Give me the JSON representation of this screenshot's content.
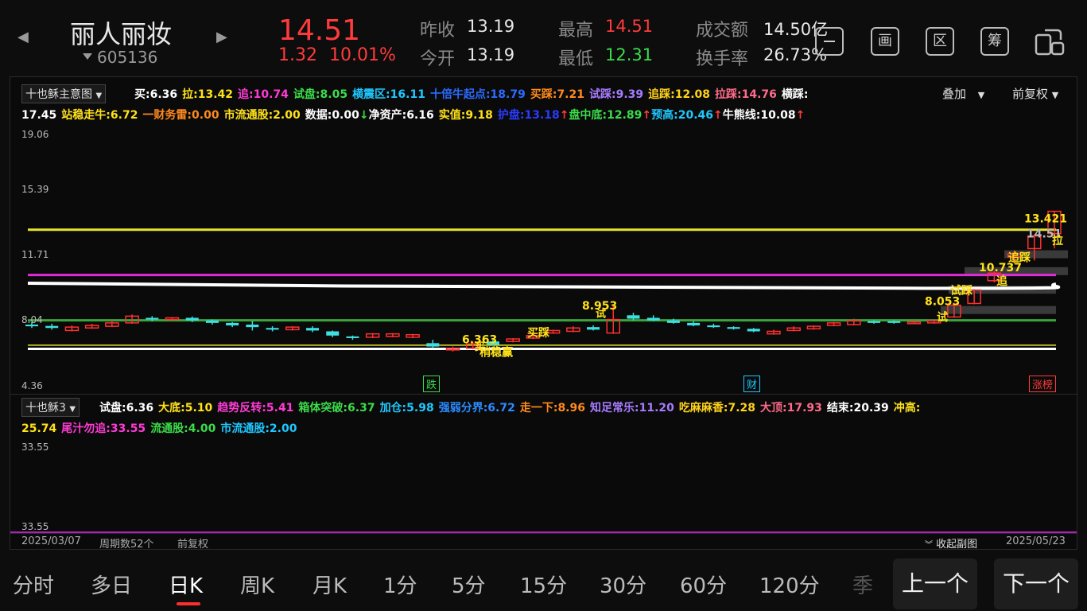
{
  "header": {
    "stock_name": "丽人丽妆",
    "stock_code": "605136",
    "price": "14.51",
    "change_abs": "1.32",
    "change_pct": "10.01%",
    "quotes": [
      {
        "label": "昨收",
        "value": "13.19",
        "color": "#e8e8e8"
      },
      {
        "label": "今开",
        "value": "13.19",
        "color": "#e8e8e8"
      },
      {
        "label": "最高",
        "value": "14.51",
        "color": "#ff3b3b"
      },
      {
        "label": "最低",
        "value": "12.31",
        "color": "#3bdc4a"
      },
      {
        "label": "成交额",
        "value": "14.50亿",
        "color": "#e8e8e8"
      },
      {
        "label": "换手率",
        "value": "26.73%",
        "color": "#e8e8e8"
      }
    ],
    "tool_icons": [
      "collapse-icon",
      "drawing-icon",
      "zone-icon",
      "chip-icon",
      "multi-window-icon"
    ],
    "tool_glyphs": [
      "",
      "画",
      "区",
      "筹",
      ""
    ]
  },
  "main_chart": {
    "indicator_name": "十也稣主意图",
    "overlay_label": "叠加",
    "adjust_label": "前复权",
    "line1": [
      {
        "text": "买:6.36",
        "color": "#ffffff"
      },
      {
        "text": "拉:13.42",
        "color": "#ffe21a"
      },
      {
        "text": "追:10.74",
        "color": "#ff3bd6"
      },
      {
        "text": "试盘:8.05",
        "color": "#3bdc4a"
      },
      {
        "text": "横震区:16.11",
        "color": "#1ec8ff"
      },
      {
        "text": "十倍牛起点:18.79",
        "color": "#2b6bff"
      },
      {
        "text": "买踩:7.21",
        "color": "#ff8a1e"
      },
      {
        "text": "试踩:9.39",
        "color": "#a77bff"
      },
      {
        "text": "追踩:12.08",
        "color": "#ffd21a"
      },
      {
        "text": "拉踩:14.76",
        "color": "#ff6b8a"
      },
      {
        "text": "横踩:",
        "color": "#ffffff"
      }
    ],
    "line2": [
      {
        "text": "17.45",
        "color": "#ffffff"
      },
      {
        "text": "站稳走牛:6.72",
        "color": "#ffe21a"
      },
      {
        "text": "一财务雷:0.00",
        "color": "#ff8a1e"
      },
      {
        "text": "市流通股:2.00",
        "color": "#ffe21a"
      },
      {
        "text": "数据:0.00",
        "color": "#ffffff"
      },
      {
        "text": "↓",
        "color": "#3bdc4a"
      },
      {
        "text": "净资产:6.16",
        "color": "#ffffff"
      },
      {
        "text": "实值:9.18",
        "color": "#ffe21a"
      },
      {
        "text": "护盘:13.18",
        "color": "#2b3bff"
      },
      {
        "text": "↑",
        "color": "#ff3b3b"
      },
      {
        "text": "盘中底:12.89",
        "color": "#3bdc4a"
      },
      {
        "text": "↑",
        "color": "#ff3b3b"
      },
      {
        "text": "预高:20.46",
        "color": "#1ec8ff"
      },
      {
        "text": "↑",
        "color": "#ff3b3b"
      },
      {
        "text": "牛熊线:10.08",
        "color": "#ffffff"
      },
      {
        "text": "↑",
        "color": "#ff3b3b"
      }
    ],
    "y_labels": [
      "19.06",
      "15.39",
      "11.71",
      "8.04",
      "4.36"
    ],
    "markers": [
      {
        "text": "跌",
        "color": "#3bdc4a"
      },
      {
        "text": "财",
        "color": "#1ec8ff"
      },
      {
        "text": "涨榜",
        "color": "#ff3b3b"
      }
    ],
    "annotations": [
      "13.421",
      "14.51",
      "拉",
      "追踩",
      "10.737",
      "追",
      "试踩",
      "8.053",
      "试",
      "8.953",
      "试",
      "买踩",
      "6.363",
      "买",
      "稍稳赢"
    ]
  },
  "sub_chart": {
    "indicator_name": "十也稣3",
    "line1": [
      {
        "text": "试盘:6.36",
        "color": "#ffffff"
      },
      {
        "text": "大底:5.10",
        "color": "#ffe21a"
      },
      {
        "text": "趋势反转:5.41",
        "color": "#ff3bd6"
      },
      {
        "text": "箱体突破:6.37",
        "color": "#3bdc4a"
      },
      {
        "text": "加仓:5.98",
        "color": "#1ec8ff"
      },
      {
        "text": "强弱分界:6.72",
        "color": "#2b8bff"
      },
      {
        "text": "走一下:8.96",
        "color": "#ff8a1e"
      },
      {
        "text": "知足常乐:11.20",
        "color": "#a77bff"
      },
      {
        "text": "吃麻麻香:7.28",
        "color": "#ffd21a"
      },
      {
        "text": "大顶:17.93",
        "color": "#ff6b8a"
      },
      {
        "text": "结束:20.39",
        "color": "#ffffff"
      },
      {
        "text": "冲高:",
        "color": "#ffe21a"
      }
    ],
    "line2": [
      {
        "text": "25.74",
        "color": "#ffe21a"
      },
      {
        "text": "尾汁勿追:33.55",
        "color": "#ff3bd6"
      },
      {
        "text": "流通股:4.00",
        "color": "#3bdc4a"
      },
      {
        "text": "市流通股:2.00",
        "color": "#1ec8ff"
      }
    ],
    "y_labels": [
      "33.55",
      "33.55"
    ]
  },
  "footer": {
    "start_date": "2025/03/07",
    "period_count": "周期数52个",
    "adjust": "前复权",
    "collapse": "收起副图",
    "end_date": "2025/05/23"
  },
  "tabs": [
    "分时",
    "多日",
    "日K",
    "周K",
    "月K",
    "1分",
    "5分",
    "15分",
    "30分",
    "60分",
    "120分",
    "季"
  ],
  "active_tab": "日K",
  "prev_button": "上一个",
  "next_button": "下一个",
  "chart_data": {
    "type": "candlestick",
    "ylim": [
      4.36,
      19.06
    ],
    "candles": [
      {
        "o": 7.8,
        "c": 7.7,
        "h": 7.95,
        "l": 7.6
      },
      {
        "o": 7.72,
        "c": 7.6,
        "h": 7.85,
        "l": 7.5
      },
      {
        "o": 7.45,
        "c": 7.65,
        "h": 7.75,
        "l": 7.4
      },
      {
        "o": 7.6,
        "c": 7.75,
        "h": 7.85,
        "l": 7.55
      },
      {
        "o": 7.7,
        "c": 7.9,
        "h": 8.05,
        "l": 7.65
      },
      {
        "o": 7.9,
        "c": 8.3,
        "h": 8.4,
        "l": 7.85
      },
      {
        "o": 8.2,
        "c": 8.1,
        "h": 8.3,
        "l": 8.0
      },
      {
        "o": 8.1,
        "c": 8.2,
        "h": 8.25,
        "l": 8.05
      },
      {
        "o": 8.2,
        "c": 8.05,
        "h": 8.28,
        "l": 7.95
      },
      {
        "o": 8.05,
        "c": 7.9,
        "h": 8.1,
        "l": 7.8
      },
      {
        "o": 7.9,
        "c": 7.75,
        "h": 7.95,
        "l": 7.65
      },
      {
        "o": 7.8,
        "c": 7.65,
        "h": 8.0,
        "l": 7.45
      },
      {
        "o": 7.6,
        "c": 7.5,
        "h": 7.7,
        "l": 7.4
      },
      {
        "o": 7.5,
        "c": 7.65,
        "h": 7.7,
        "l": 7.45
      },
      {
        "o": 7.6,
        "c": 7.45,
        "h": 7.7,
        "l": 7.35
      },
      {
        "o": 7.4,
        "c": 7.15,
        "h": 7.45,
        "l": 7.05
      },
      {
        "o": 7.1,
        "c": 7.0,
        "h": 7.15,
        "l": 6.9
      },
      {
        "o": 7.05,
        "c": 7.25,
        "h": 7.3,
        "l": 7.0
      },
      {
        "o": 7.1,
        "c": 7.25,
        "h": 7.3,
        "l": 7.05
      },
      {
        "o": 7.05,
        "c": 7.2,
        "h": 7.25,
        "l": 7.0
      },
      {
        "o": 6.7,
        "c": 6.5,
        "h": 6.9,
        "l": 6.4
      },
      {
        "o": 6.3,
        "c": 6.4,
        "h": 6.5,
        "l": 6.2
      },
      {
        "o": 6.4,
        "c": 6.65,
        "h": 6.75,
        "l": 6.35
      },
      {
        "o": 6.8,
        "c": 6.6,
        "h": 6.9,
        "l": 6.55
      },
      {
        "o": 6.8,
        "c": 6.95,
        "h": 7.0,
        "l": 6.75
      },
      {
        "o": 7.0,
        "c": 7.15,
        "h": 7.2,
        "l": 6.95
      },
      {
        "o": 7.3,
        "c": 7.45,
        "h": 7.5,
        "l": 7.25
      },
      {
        "o": 7.4,
        "c": 7.6,
        "h": 7.7,
        "l": 7.35
      },
      {
        "o": 7.65,
        "c": 7.5,
        "h": 7.75,
        "l": 7.45
      },
      {
        "o": 7.3,
        "c": 8.1,
        "h": 8.95,
        "l": 7.25
      },
      {
        "o": 8.35,
        "c": 8.15,
        "h": 8.5,
        "l": 8.05
      },
      {
        "o": 8.2,
        "c": 8.05,
        "h": 8.35,
        "l": 8.0
      },
      {
        "o": 8.05,
        "c": 7.9,
        "h": 8.15,
        "l": 7.85
      },
      {
        "o": 7.9,
        "c": 7.75,
        "h": 8.0,
        "l": 7.7
      },
      {
        "o": 7.75,
        "c": 7.65,
        "h": 7.85,
        "l": 7.6
      },
      {
        "o": 7.65,
        "c": 7.55,
        "h": 7.7,
        "l": 7.5
      },
      {
        "o": 7.55,
        "c": 7.4,
        "h": 7.6,
        "l": 7.35
      },
      {
        "o": 7.25,
        "c": 7.4,
        "h": 7.5,
        "l": 7.2
      },
      {
        "o": 7.45,
        "c": 7.6,
        "h": 7.7,
        "l": 7.4
      },
      {
        "o": 7.55,
        "c": 7.7,
        "h": 7.75,
        "l": 7.5
      },
      {
        "o": 7.75,
        "c": 7.9,
        "h": 7.95,
        "l": 7.7
      },
      {
        "o": 7.8,
        "c": 8.05,
        "h": 8.15,
        "l": 7.75
      },
      {
        "o": 8.0,
        "c": 7.9,
        "h": 8.05,
        "l": 7.85
      },
      {
        "o": 8.0,
        "c": 7.9,
        "h": 8.05,
        "l": 7.85
      },
      {
        "o": 7.95,
        "c": 7.95,
        "h": 8.05,
        "l": 7.85
      },
      {
        "o": 7.9,
        "c": 8.05,
        "h": 8.1,
        "l": 7.85
      },
      {
        "o": 8.25,
        "c": 8.95,
        "h": 9.1,
        "l": 8.2
      },
      {
        "o": 9.05,
        "c": 9.85,
        "h": 9.9,
        "l": 9.0
      },
      {
        "o": 10.4,
        "c": 10.85,
        "h": 10.95,
        "l": 10.3
      },
      {
        "o": 11.8,
        "c": 12.0,
        "h": 12.2,
        "l": 11.4
      },
      {
        "o": 12.3,
        "c": 13.05,
        "h": 13.15,
        "l": 11.6
      },
      {
        "o": 13.19,
        "c": 14.51,
        "h": 14.51,
        "l": 12.31
      }
    ],
    "lines": [
      {
        "name": "拉",
        "value": 13.42,
        "color": "#e6e62a"
      },
      {
        "name": "追",
        "value": 10.74,
        "color": "#e02ad6"
      },
      {
        "name": "试盘",
        "value": 8.05,
        "color": "#3ca43c"
      },
      {
        "name": "买",
        "value": 6.36,
        "color": "#ffffff"
      }
    ]
  }
}
